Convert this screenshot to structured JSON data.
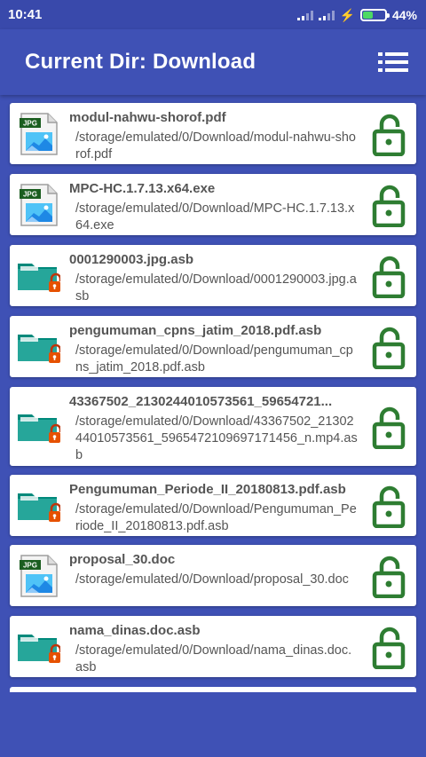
{
  "status": {
    "time": "10:41",
    "battery": "44%",
    "battery_level": 0.44
  },
  "toolbar": {
    "title": "Current Dir: Download"
  },
  "icons": {
    "menu": "list-menu-icon",
    "lock": "unlocked-padlock-icon",
    "jpg": "jpg-image-file-icon",
    "folder": "locked-folder-icon"
  },
  "colors": {
    "primary": "#3f51b5",
    "status_bar": "#3949ab",
    "lock_green": "#2e7d32",
    "folder_teal": "#26a69a"
  },
  "files": [
    {
      "name": "modul-nahwu-shorof.pdf",
      "path": "/storage/emulated/0/Download/modul-nahwu-shorof.pdf",
      "thumb": "jpg"
    },
    {
      "name": "MPC-HC.1.7.13.x64.exe",
      "path": "/storage/emulated/0/Download/MPC-HC.1.7.13.x64.exe",
      "thumb": "jpg"
    },
    {
      "name": "0001290003.jpg.asb",
      "path": "/storage/emulated/0/Download/0001290003.jpg.asb",
      "thumb": "folder"
    },
    {
      "name": "pengumuman_cpns_jatim_2018.pdf.asb",
      "path": "/storage/emulated/0/Download/pengumuman_cpns_jatim_2018.pdf.asb",
      "thumb": "folder"
    },
    {
      "name": "43367502_2130244010573561_59654721...",
      "path": "/storage/emulated/0/Download/43367502_2130244010573561_5965472109697171456_n.mp4.asb",
      "thumb": "folder"
    },
    {
      "name": "Pengumuman_Periode_II_20180813.pdf.asb",
      "path": "/storage/emulated/0/Download/Pengumuman_Periode_II_20180813.pdf.asb",
      "thumb": "folder"
    },
    {
      "name": "proposal_30.doc",
      "path": "/storage/emulated/0/Download/proposal_30.doc",
      "thumb": "jpg"
    },
    {
      "name": "nama_dinas.doc.asb",
      "path": "/storage/emulated/0/Download/nama_dinas.doc.asb",
      "thumb": "folder"
    }
  ]
}
